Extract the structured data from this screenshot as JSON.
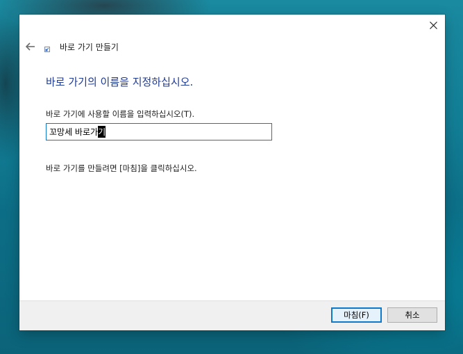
{
  "window": {
    "close_glyph": "✕"
  },
  "header": {
    "back_glyph": "←",
    "title": "바로 가기 만들기"
  },
  "content": {
    "main_instruction": "바로 가기의 이름을 지정하십시오.",
    "prompt_label": "바로 가기에 사용할 이름을 입력하십시오(T).",
    "input_value_prefix": "꼬망세 바로가",
    "input_value_selected": "기",
    "finish_hint": "바로 가기를 만들려면 [마침]을 클릭하십시오."
  },
  "footer": {
    "finish_label": "마침(F)",
    "cancel_label": "취소"
  },
  "icons": {
    "close": "close-icon",
    "back": "arrow-left-icon",
    "wizard": "shortcut-wizard-icon"
  },
  "colors": {
    "accent": "#0f78c8",
    "instruction_text": "#1f3a93"
  }
}
